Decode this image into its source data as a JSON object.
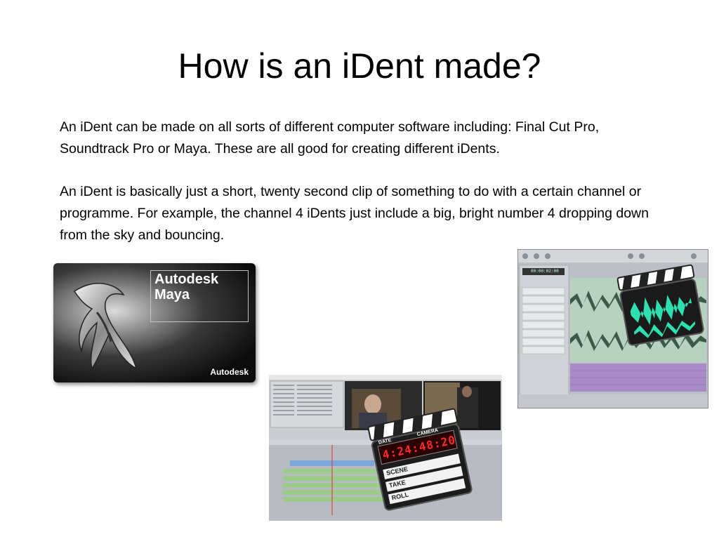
{
  "slide": {
    "title": "How is an iDent made?",
    "paragraphs": [
      "An iDent can be made on all sorts of different computer software including: Final Cut Pro, Soundtrack Pro or Maya. These are all good for creating different iDents.",
      "An iDent is basically just a short, twenty second clip of something to do with a certain channel or programme. For example, the channel 4 iDents just include a big, bright number 4 dropping down from the sky and bouncing."
    ]
  },
  "maya_image": {
    "brand": "Autodesk",
    "product": "Maya",
    "corner_brand": "Autodesk"
  },
  "fcp_image": {
    "icon": "clapperboard-icon",
    "clapper_labels": {
      "date": "DATE",
      "camera": "CAMERA",
      "scene": "SCENE",
      "take": "TAKE",
      "roll": "ROLL"
    },
    "timecode": "4:24:48:20"
  },
  "stp_image": {
    "icon": "clapperboard-waveform-icon",
    "timecode": "00:00:02:00"
  },
  "colors": {
    "waveform": "#3c5a48",
    "timecode_led": "#ff2a2a",
    "wave_icon": "#2ee0b0"
  }
}
